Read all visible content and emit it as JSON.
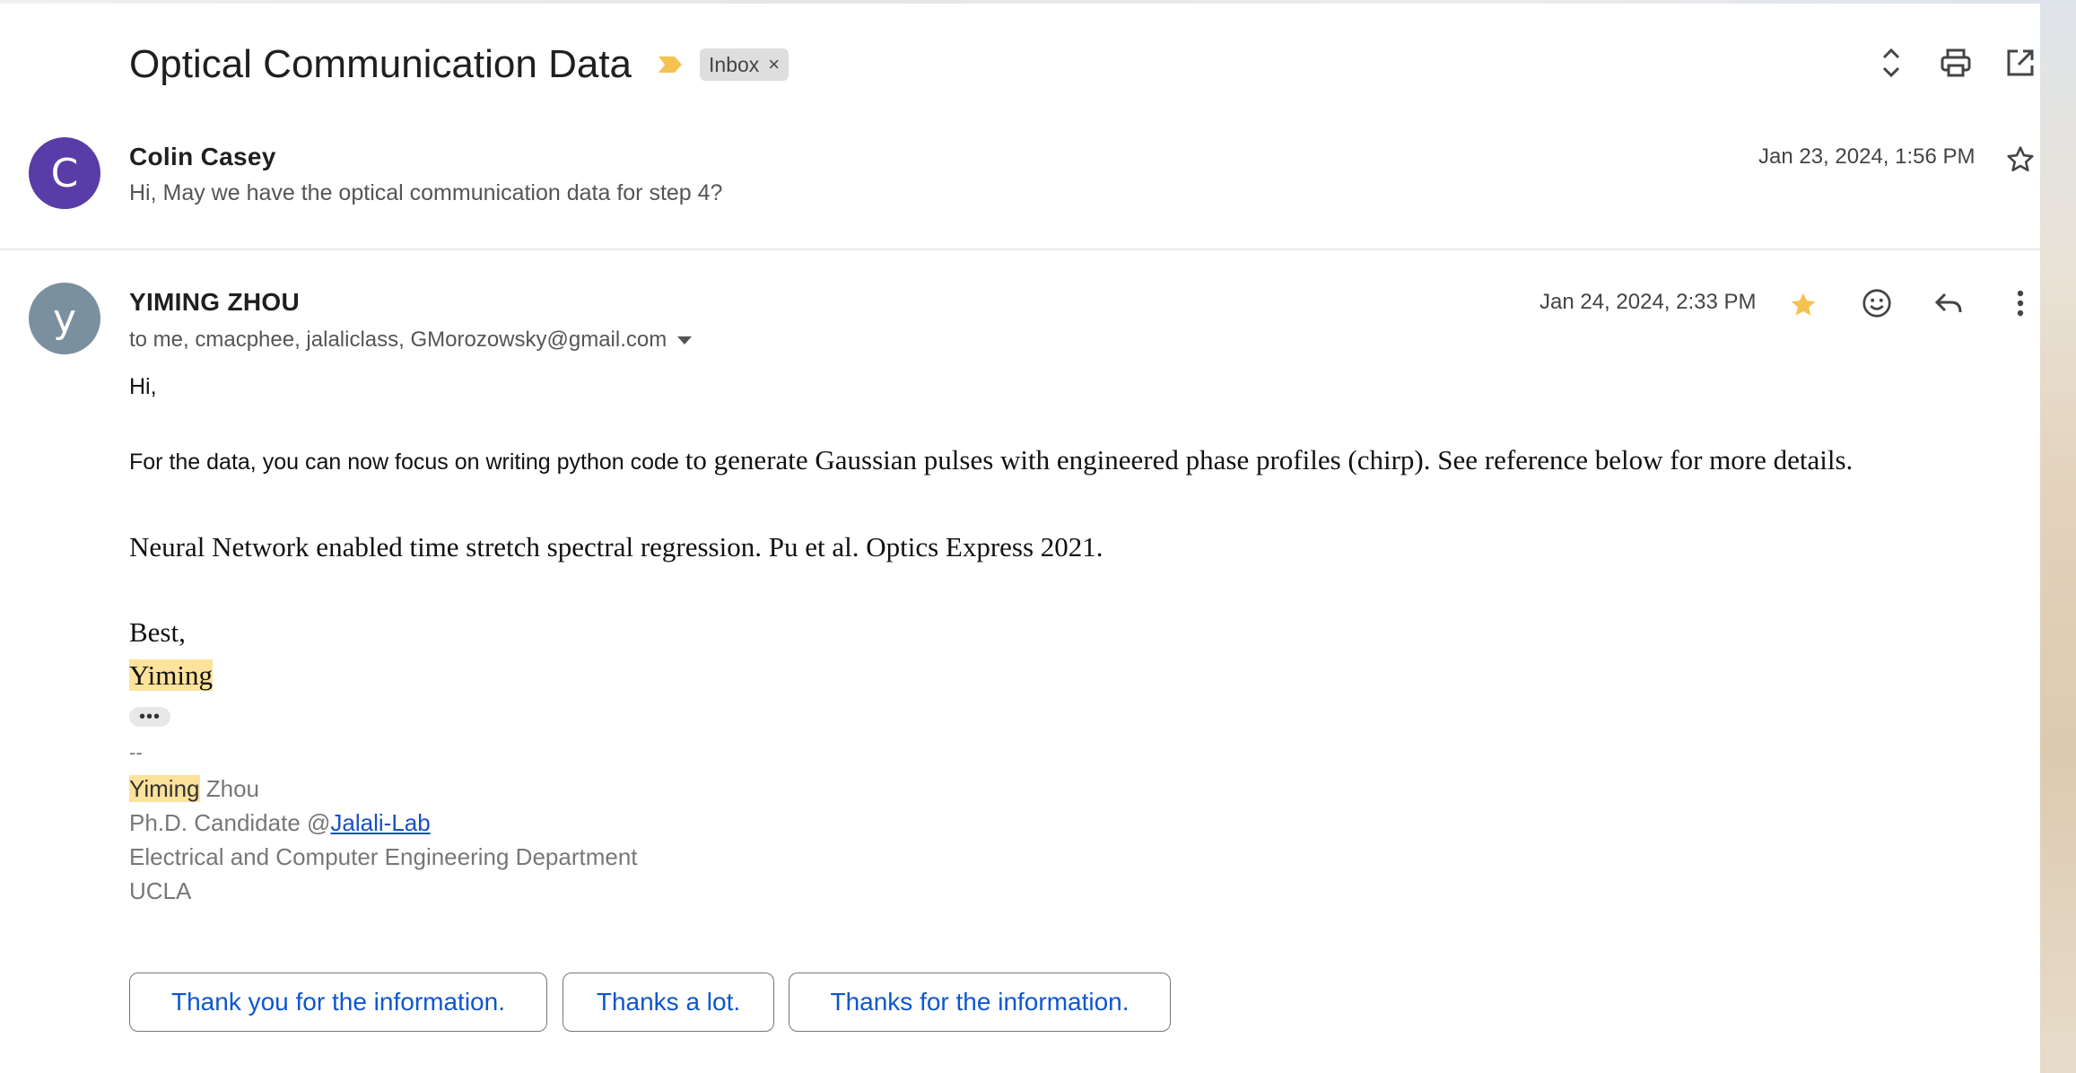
{
  "thread": {
    "subject": "Optical Communication Data",
    "label": "Inbox",
    "label_remove": "×"
  },
  "toolbar": {
    "icons": [
      "expand-collapse-icon",
      "print-icon",
      "open-in-new-window-icon"
    ]
  },
  "message1": {
    "avatar_letter": "C",
    "avatar_color": "#5a3ca8",
    "sender": "Colin Casey",
    "snippet": "Hi, May we have the optical communication data for step 4?",
    "date": "Jan 23, 2024, 1:56 PM"
  },
  "message2": {
    "avatar_letter": "y",
    "avatar_color": "#7b909e",
    "sender": "YIMING ZHOU",
    "recipients": "to me, cmacphee, jalaliclass, GMorozowsky@gmail.com",
    "date": "Jan 24, 2024, 2:33 PM",
    "starred_color": "#f4c34f",
    "body": {
      "greeting": "Hi,",
      "line1_sans": "For the data, you can now focus on writing python code ",
      "line1_serif": "to generate Gaussian pulses with engineered phase profiles (chirp). See reference below for more details.",
      "reference": "Neural Network enabled time stretch spectral regression. Pu et al. Optics Express 2021.",
      "closing": "Best,",
      "name": "Yiming",
      "trimmed_indicator": "•••"
    },
    "signature": {
      "separator": "--",
      "first_name": "Yiming",
      "last_name": " Zhou",
      "title_prefix": "Ph.D. Candidate @",
      "lab_link": "Jalali-Lab",
      "department": "Electrical and Computer Engineering Department",
      "school": "UCLA"
    }
  },
  "smart_replies": [
    "Thank you for the information.",
    "Thanks a lot.",
    "Thanks for the information."
  ]
}
